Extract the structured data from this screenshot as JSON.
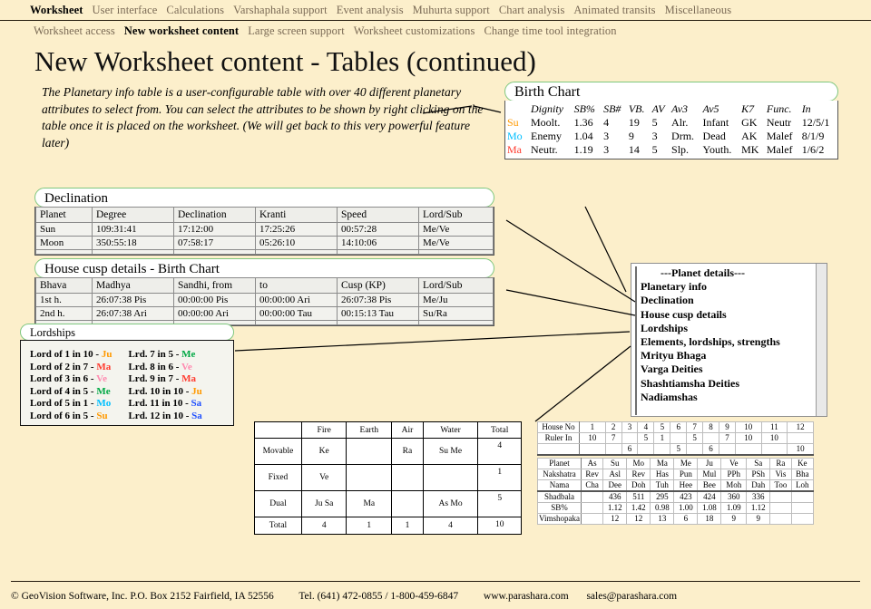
{
  "menubar": {
    "primary": [
      {
        "label": "Worksheet",
        "active": true
      },
      {
        "label": "User interface",
        "active": false
      },
      {
        "label": "Calculations",
        "active": false
      },
      {
        "label": "Varshaphala support",
        "active": false
      },
      {
        "label": "Event analysis",
        "active": false
      },
      {
        "label": "Muhurta support",
        "active": false
      },
      {
        "label": "Chart analysis",
        "active": false
      },
      {
        "label": "Animated transits",
        "active": false
      },
      {
        "label": "Miscellaneous",
        "active": false
      }
    ],
    "secondary": [
      {
        "label": "Worksheet access",
        "active": false
      },
      {
        "label": "New worksheet content",
        "active": true
      },
      {
        "label": "Large screen support",
        "active": false
      },
      {
        "label": "Worksheet customizations",
        "active": false
      },
      {
        "label": "Change time tool integration",
        "active": false
      }
    ]
  },
  "page": {
    "title": "New Worksheet content - Tables (continued)",
    "description": "The Planetary info table is a user-configurable table with over 40 different planetary attributes to select from. You can select the attributes to be shown by right clicking on the table once it is placed on the worksheet. (We will get back to this very powerful feature later)"
  },
  "birth_chart": {
    "title": "Birth Chart",
    "columns": [
      "Dignity",
      "SB%",
      "SB#",
      "VB.",
      "AV",
      "Av3",
      "Av5",
      "K7",
      "Func.",
      "In"
    ],
    "rows": [
      {
        "planet": "Su",
        "color": "#ff9900",
        "cells": [
          "Moolt.",
          "1.36",
          "4",
          "19",
          "5",
          "Alr.",
          "Infant",
          "GK",
          "Neutr",
          "12/5/1"
        ]
      },
      {
        "planet": "Mo",
        "color": "#00bfff",
        "cells": [
          "Enemy",
          "1.04",
          "3",
          "9",
          "3",
          "Drm.",
          "Dead",
          "AK",
          "Malef",
          "8/1/9"
        ]
      },
      {
        "planet": "Ma",
        "color": "#ff3b2f",
        "cells": [
          "Neutr.",
          "1.19",
          "3",
          "14",
          "5",
          "Slp.",
          "Youth.",
          "MK",
          "Malef",
          "1/6/2"
        ]
      }
    ]
  },
  "declination": {
    "title": "Declination",
    "columns": [
      "Planet",
      "Degree",
      "Declination",
      "Kranti",
      "Speed",
      "Lord/Sub"
    ],
    "rows": [
      [
        "Sun",
        "109:31:41",
        "17:12:00",
        "17:25:26",
        "00:57:28",
        "Me/Ve"
      ],
      [
        "Moon",
        "350:55:18",
        "07:58:17",
        "05:26:10",
        "14:10:06",
        "Me/Ve"
      ]
    ]
  },
  "house_cusp": {
    "title": "House cusp details - Birth Chart",
    "columns": [
      "Bhava",
      "Madhya",
      "Sandhi, from",
      "to",
      "Cusp (KP)",
      "Lord/Sub"
    ],
    "rows": [
      [
        "1st h.",
        "26:07:38 Pis",
        "00:00:00 Pis",
        "00:00:00 Ari",
        "26:07:38 Pis",
        "Me/Ju"
      ],
      [
        "2nd h.",
        "26:07:38 Ari",
        "00:00:00 Ari",
        "00:00:00 Tau",
        "00:15:13 Tau",
        "Su/Ra"
      ]
    ]
  },
  "lordships": {
    "title": "Lordships",
    "left_column": [
      {
        "text": "Lord of 1 in 10 - ",
        "abbr": "Ju",
        "color": "#ff9900"
      },
      {
        "text": "Lord of 2 in 7 - ",
        "abbr": "Ma",
        "color": "#ff3b2f"
      },
      {
        "text": "Lord of 3 in 6 - ",
        "abbr": "Ve",
        "color": "#ff8ab0"
      },
      {
        "text": "Lord of 4 in 5 - ",
        "abbr": "Me",
        "color": "#00a844"
      },
      {
        "text": "Lord of 5 in 1 - ",
        "abbr": "Mo",
        "color": "#00bfff"
      },
      {
        "text": "Lord of 6 in 5 - ",
        "abbr": "Su",
        "color": "#ff9900"
      }
    ],
    "right_column": [
      {
        "text": "Lrd. 7 in 5 - ",
        "abbr": "Me",
        "color": "#00a844"
      },
      {
        "text": "Lrd. 8 in 6 - ",
        "abbr": "Ve",
        "color": "#ff8ab0"
      },
      {
        "text": "Lrd. 9 in 7 - ",
        "abbr": "Ma",
        "color": "#ff3b2f"
      },
      {
        "text": "Lrd. 10 in 10 - ",
        "abbr": "Ju",
        "color": "#ff9900"
      },
      {
        "text": "Lrd. 11 in 10 - ",
        "abbr": "Sa",
        "color": "#2050ff"
      },
      {
        "text": "Lrd. 12 in 10 - ",
        "abbr": "Sa",
        "color": "#2050ff"
      }
    ]
  },
  "planet_menu": {
    "items": [
      "---Planet details---",
      "Planetary info",
      "Declination",
      "House cusp details",
      "Lordships",
      "Elements, lordships, strengths",
      "Mrityu Bhaga",
      "Varga Deities",
      "Shashtiamsha Deities",
      "Nadiamshas"
    ]
  },
  "elements_table": {
    "columns": [
      "",
      "Fire",
      "Earth",
      "Air",
      "Water",
      "Total"
    ],
    "rows": [
      [
        "Movable",
        "Ke",
        "",
        "Ra",
        "Su Me",
        "4"
      ],
      [
        "Fixed",
        "Ve",
        "",
        "",
        "",
        "1"
      ],
      [
        "Dual",
        "Ju Sa",
        "Ma",
        "",
        "As Mo",
        "5"
      ],
      [
        "Total",
        "4",
        "1",
        "1",
        "4",
        "10"
      ]
    ]
  },
  "house_table": {
    "house_no_label": "House No",
    "house_numbers": [
      "1",
      "2",
      "3",
      "4",
      "5",
      "6",
      "7",
      "8",
      "9",
      "10",
      "11",
      "12"
    ],
    "ruler_in_label": "Ruler In",
    "ruler_in_row1": [
      "10",
      "7",
      "",
      "5",
      "1",
      "",
      "5",
      "",
      "7",
      "10",
      "10",
      ""
    ],
    "ruler_in_row2": [
      "",
      "",
      "6",
      "",
      "",
      "5",
      "",
      "6",
      "",
      "",
      "",
      "10"
    ],
    "planet_label": "Planet",
    "planets": [
      "As",
      "Su",
      "Mo",
      "Ma",
      "Me",
      "Ju",
      "Ve",
      "Sa",
      "Ra",
      "Ke"
    ],
    "nakshatra_label": "Nakshatra",
    "nakshatras": [
      "Rev",
      "Asl",
      "Rev",
      "Has",
      "Pun",
      "Mul",
      "PPh",
      "PSh",
      "Vis",
      "Bha"
    ],
    "nama_label": "Nama",
    "namas": [
      "Cha",
      "Dee",
      "Doh",
      "Tuh",
      "Hee",
      "Bee",
      "Moh",
      "Dah",
      "Too",
      "Loh"
    ],
    "shadbala_label": "Shadbala",
    "shadbala": [
      "",
      "436",
      "511",
      "295",
      "423",
      "424",
      "360",
      "336",
      "",
      ""
    ],
    "sbpct_label": "SB%",
    "sbpct": [
      "",
      "1.12",
      "1.42",
      "0.98",
      "1.00",
      "1.08",
      "1.09",
      "1.12",
      "",
      ""
    ],
    "vimshopaka_label": "Vimshopaka",
    "vimshopaka": [
      "",
      "12",
      "12",
      "13",
      "6",
      "18",
      "9",
      "9",
      "",
      ""
    ]
  },
  "footer": {
    "company": "© GeoVision Software, Inc. P.O. Box 2152 Fairfield, IA 52556",
    "phone": "Tel. (641) 472-0855 / 1-800-459-6847",
    "website": "www.parashara.com",
    "email": "sales@parashara.com"
  }
}
